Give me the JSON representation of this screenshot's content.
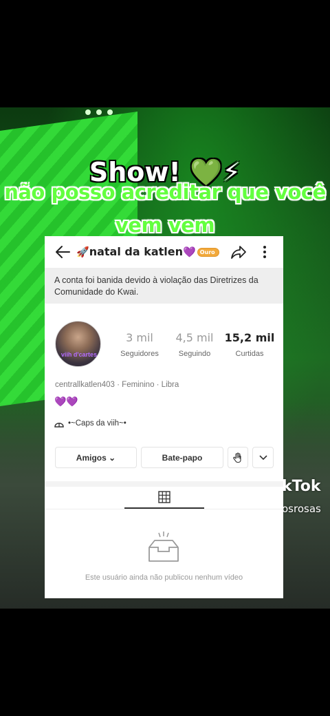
{
  "overlay": {
    "caption_show": "Show! 💚⚡",
    "caption_line1": "não posso acreditar que você",
    "caption_line2": "vem vem",
    "watermark": "kTok",
    "watermark_handle": "osrosas"
  },
  "profile": {
    "title": "natal da katlen",
    "title_prefix_emoji": "🚀",
    "title_suffix_emoji": "💜",
    "badge": "Ouro",
    "ban_notice": "A conta foi banida devido à violação das Diretrizes da Comunidade do Kwai.",
    "avatar_text": "viih d'cartes",
    "stats": [
      {
        "value": "3 mil",
        "label": "Seguidores"
      },
      {
        "value": "4,5 mil",
        "label": "Seguindo"
      },
      {
        "value": "15,2 mil",
        "label": "Curtidas"
      }
    ],
    "meta": "centrallkatlen403 · Feminino · Libra",
    "bio": "💜💜",
    "linked_account": "•~Caps da viih~•",
    "buttons": {
      "friends": "Amigos ⌄",
      "chat": "Bate-papo"
    },
    "empty_message": "Este usuário ainda não publicou nenhum vídeo"
  },
  "colors": {
    "caption_green": "#63ff3f",
    "badge": "#f2a93b",
    "banner_bg": "#eeeeee"
  }
}
